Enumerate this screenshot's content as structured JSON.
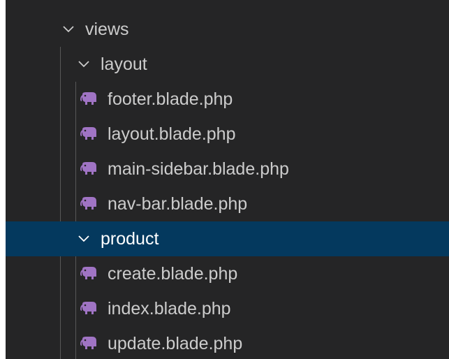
{
  "colors": {
    "panel_bg": "#252526",
    "selection_bg": "#04395e",
    "text": "#cccccc",
    "text_selected": "#ffffff",
    "php_icon": "#a074c4"
  },
  "tree": {
    "views": {
      "label": "views",
      "expanded": true,
      "icon": "chevron-down-icon"
    },
    "layout": {
      "label": "layout",
      "expanded": true,
      "icon": "chevron-down-icon",
      "files": [
        {
          "label": "footer.blade.php",
          "icon": "php-elephant-icon"
        },
        {
          "label": "layout.blade.php",
          "icon": "php-elephant-icon"
        },
        {
          "label": "main-sidebar.blade.php",
          "icon": "php-elephant-icon"
        },
        {
          "label": "nav-bar.blade.php",
          "icon": "php-elephant-icon"
        }
      ]
    },
    "product": {
      "label": "product",
      "expanded": true,
      "selected": true,
      "icon": "chevron-down-icon",
      "files": [
        {
          "label": "create.blade.php",
          "icon": "php-elephant-icon"
        },
        {
          "label": "index.blade.php",
          "icon": "php-elephant-icon"
        },
        {
          "label": "update.blade.php",
          "icon": "php-elephant-icon"
        }
      ]
    }
  }
}
